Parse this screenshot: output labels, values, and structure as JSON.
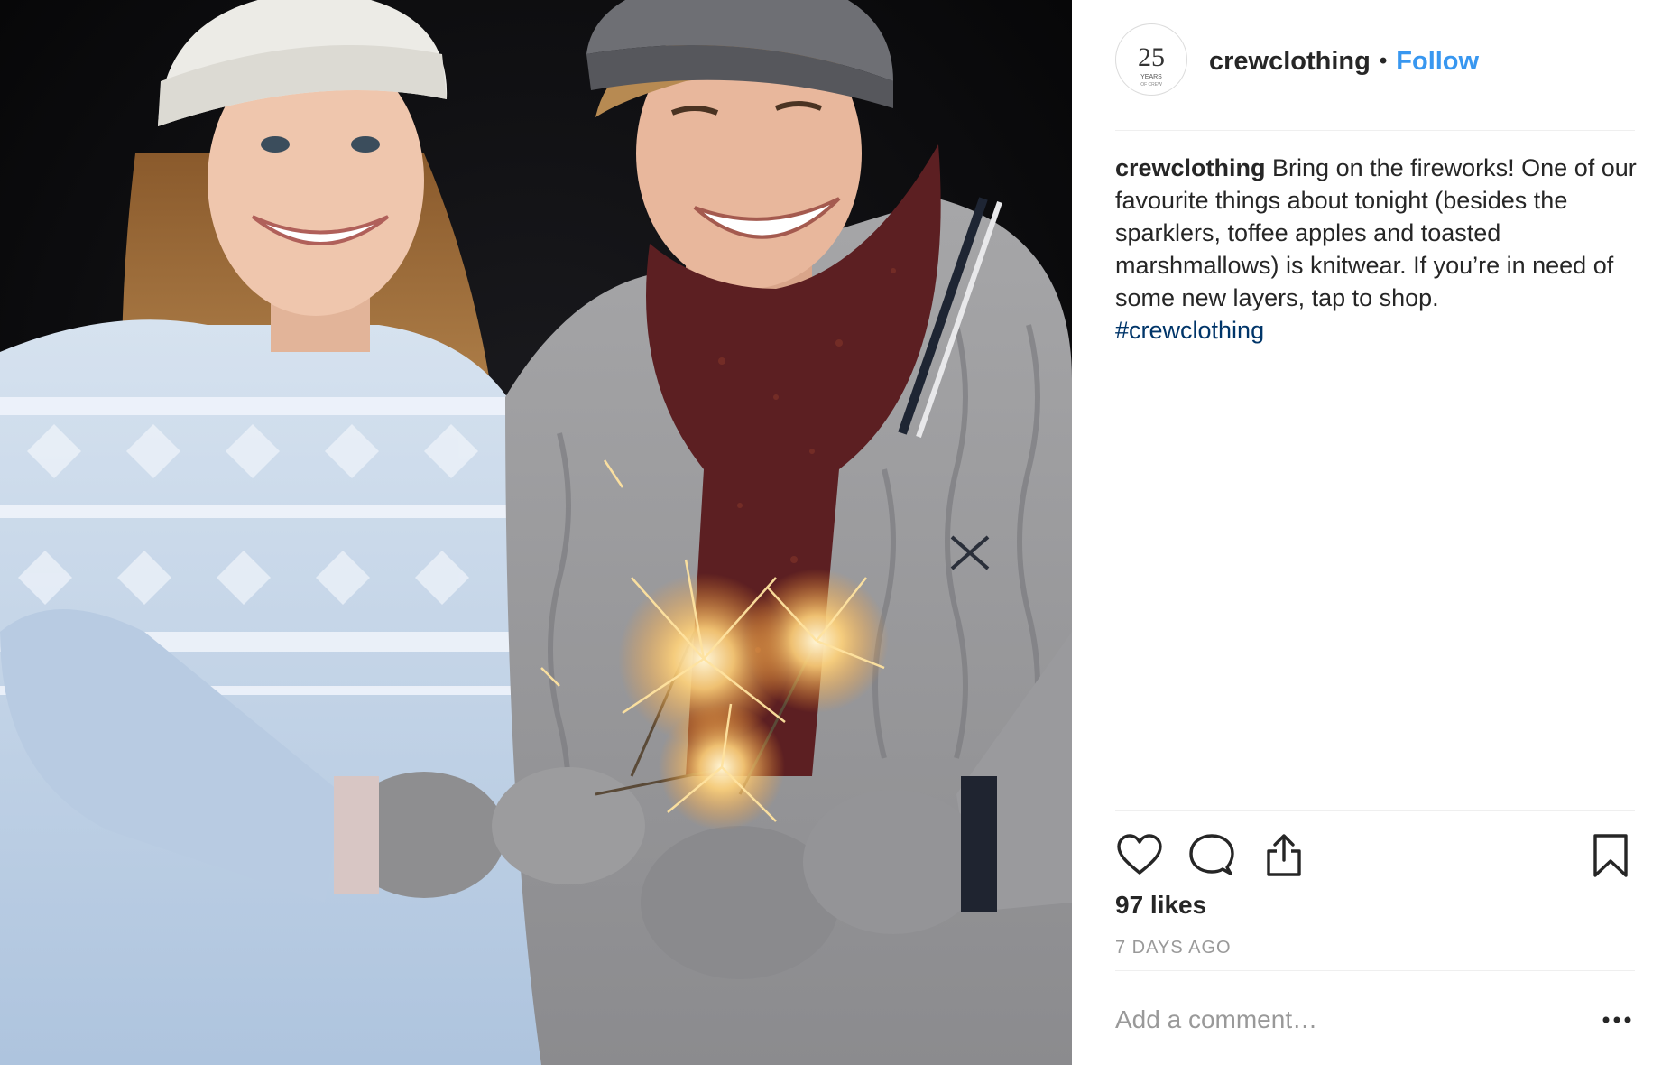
{
  "post": {
    "account": {
      "username": "crewclothing",
      "follow_label": "Follow",
      "separator": "•",
      "avatar_number": "25",
      "avatar_caption": "YEARS",
      "avatar_subcaption": "OF CREW"
    },
    "caption": {
      "username": "crewclothing",
      "text": "Bring on the fireworks! One of our favourite things about tonight (besides the sparklers, toffee apples and toasted marshmallows) is knitwear. If you’re in need of some new layers, tap to shop.",
      "hashtag": "#crewclothing"
    },
    "actions": {
      "like_icon": "heart-icon",
      "comment_icon": "comment-icon",
      "share_icon": "share-icon",
      "save_icon": "bookmark-icon"
    },
    "likes": "97 likes",
    "timestamp": "7 DAYS AGO",
    "comment": {
      "placeholder": "Add a comment…",
      "more_icon": "more-options-icon"
    }
  },
  "colors": {
    "follow": "#3897f0",
    "hashtag": "#003569",
    "muted": "#999999",
    "text": "#262626",
    "divider": "#efefef"
  }
}
